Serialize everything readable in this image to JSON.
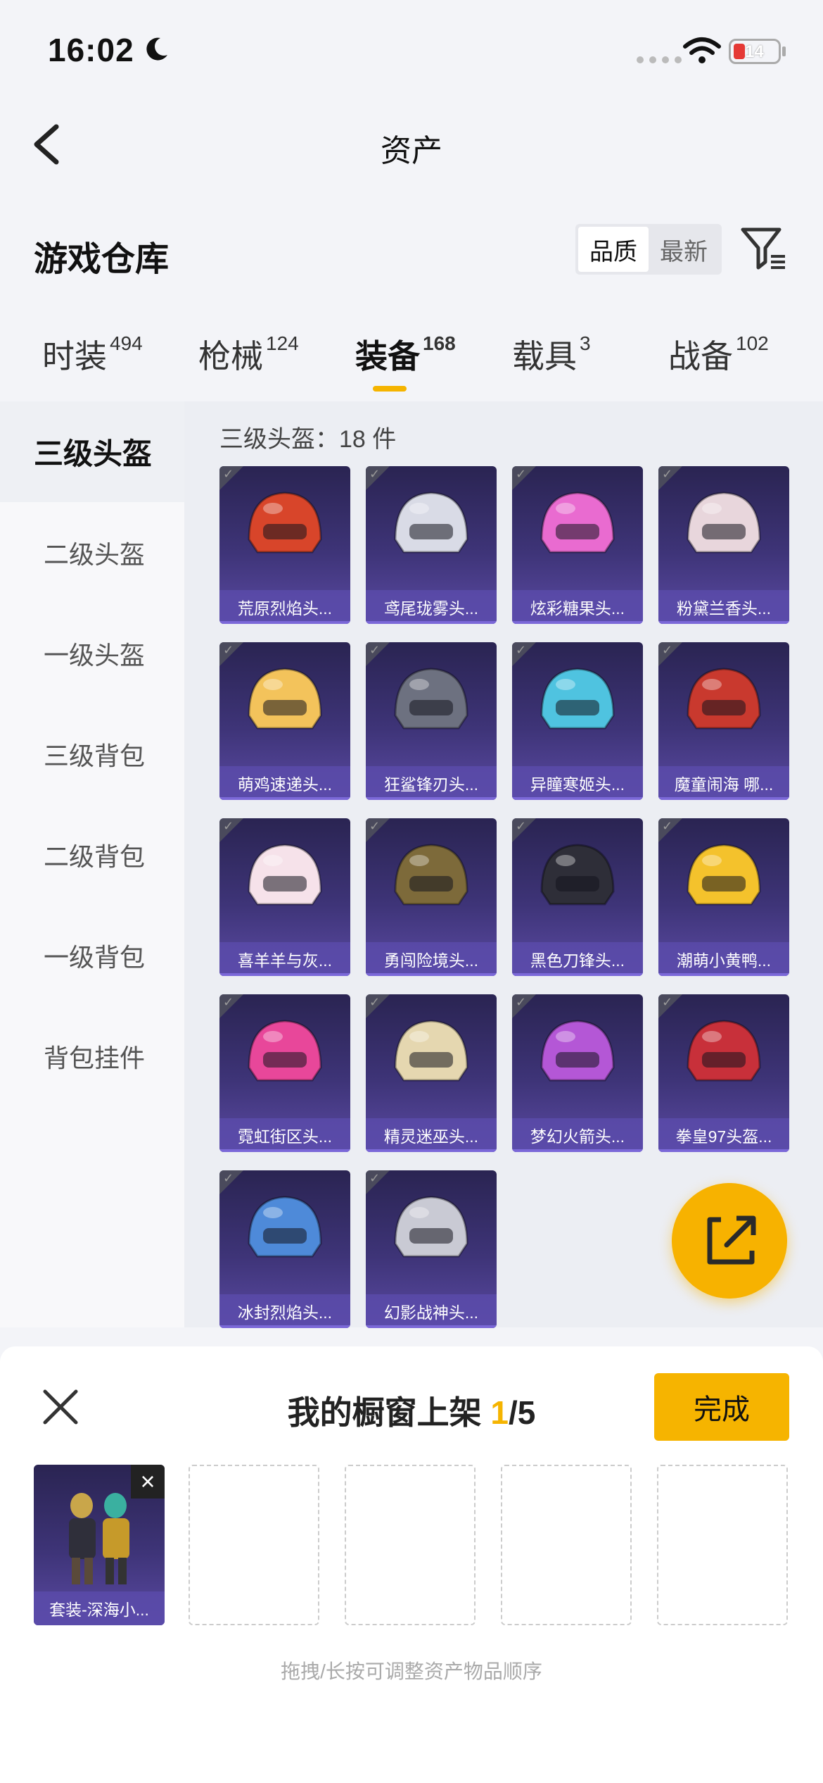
{
  "status_bar": {
    "time": "16:02",
    "battery": "14"
  },
  "nav": {
    "title": "资产"
  },
  "section": {
    "title": "游戏仓库",
    "sort_options": [
      "品质",
      "最新"
    ],
    "active_sort": "品质"
  },
  "tabs": [
    {
      "label": "时装",
      "count": "494"
    },
    {
      "label": "枪械",
      "count": "124"
    },
    {
      "label": "装备",
      "count": "168"
    },
    {
      "label": "载具",
      "count": "3"
    },
    {
      "label": "战备",
      "count": "102"
    }
  ],
  "active_tab": "装备",
  "sidebar": {
    "items": [
      "三级头盔",
      "二级头盔",
      "一级头盔",
      "三级背包",
      "二级背包",
      "一级背包",
      "背包挂件"
    ]
  },
  "grid": {
    "label": "三级头盔：18 件",
    "items": [
      {
        "name": "荒原烈焰头...",
        "color": "#d8452a"
      },
      {
        "name": "鸢尾珑雾头...",
        "color": "#d9dbe6"
      },
      {
        "name": "炫彩糖果头...",
        "color": "#e96bd0"
      },
      {
        "name": "粉黛兰香头...",
        "color": "#e8d6dc"
      },
      {
        "name": "萌鸡速递头...",
        "color": "#f3c35b"
      },
      {
        "name": "狂鲨锋刃头...",
        "color": "#6d7180"
      },
      {
        "name": "异瞳寒姬头...",
        "color": "#4fc3e0"
      },
      {
        "name": "魔童闹海 哪...",
        "color": "#c9392e"
      },
      {
        "name": "喜羊羊与灰...",
        "color": "#f6e2ea"
      },
      {
        "name": "勇闯险境头...",
        "color": "#7d6a3a"
      },
      {
        "name": "黑色刀锋头...",
        "color": "#2e2e38"
      },
      {
        "name": "潮萌小黄鸭...",
        "color": "#f4c22c"
      },
      {
        "name": "霓虹街区头...",
        "color": "#e8479a"
      },
      {
        "name": "精灵迷巫头...",
        "color": "#e5d7b0"
      },
      {
        "name": "梦幻火箭头...",
        "color": "#b457d6"
      },
      {
        "name": "拳皇97头盔...",
        "color": "#c8303a"
      },
      {
        "name": "冰封烈焰头...",
        "color": "#4e8ad9"
      },
      {
        "name": "幻影战神头...",
        "color": "#c9cad4"
      }
    ]
  },
  "showcase": {
    "title_prefix": "我的橱窗上架 ",
    "current": "1",
    "total": "/5",
    "done_label": "完成",
    "slots": [
      {
        "name": "套装-深海小..."
      }
    ],
    "hint": "拖拽/长按可调整资产物品顺序"
  }
}
